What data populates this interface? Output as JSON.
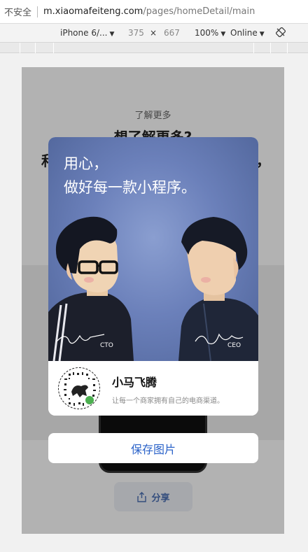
{
  "browser": {
    "security_label": "不安全",
    "url_host": "m.xiaomafeiteng.com",
    "url_path": "/pages/homeDetail/main"
  },
  "devtools": {
    "device": "iPhone 6/...",
    "width": "375",
    "times": "×",
    "height": "667",
    "zoom": "100%",
    "throttle": "Online"
  },
  "page": {
    "subtitle": "了解更多",
    "title_line1": "想了解更多?",
    "title_fragment_left": "和",
    "title_fragment_right": "，",
    "share_label": "分享"
  },
  "poster": {
    "headline_line1": "用心，",
    "headline_line2": "做好每一款小程序。",
    "left_role": "CTO",
    "right_role": "CEO",
    "app_name": "小马飞腾",
    "app_description": "让每一个商家拥有自己的电商渠道。"
  },
  "modal": {
    "save_label": "保存图片"
  },
  "colors": {
    "accent": "#2b63c9",
    "poster_bg": "#6b80ba"
  }
}
